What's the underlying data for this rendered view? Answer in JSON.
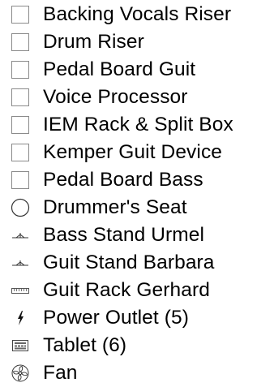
{
  "legend": {
    "items": [
      {
        "label": "Backing Vocals Riser",
        "icon": "square-icon"
      },
      {
        "label": "Drum Riser",
        "icon": "square-icon"
      },
      {
        "label": "Pedal Board Guit",
        "icon": "square-icon"
      },
      {
        "label": "Voice Processor",
        "icon": "square-icon"
      },
      {
        "label": "IEM Rack & Split Box",
        "icon": "square-icon"
      },
      {
        "label": "Kemper Guit Device",
        "icon": "square-icon"
      },
      {
        "label": "Pedal Board Bass",
        "icon": "square-icon"
      },
      {
        "label": "Drummer's Seat",
        "icon": "circle-icon"
      },
      {
        "label": "Bass Stand Urmel",
        "icon": "stand-icon"
      },
      {
        "label": "Guit Stand Barbara",
        "icon": "stand-icon"
      },
      {
        "label": "Guit Rack Gerhard",
        "icon": "rack-icon"
      },
      {
        "label": "Power Outlet (5)",
        "icon": "lightning-icon"
      },
      {
        "label": "Tablet (6)",
        "icon": "tablet-icon"
      },
      {
        "label": "Fan",
        "icon": "fan-icon"
      }
    ]
  }
}
